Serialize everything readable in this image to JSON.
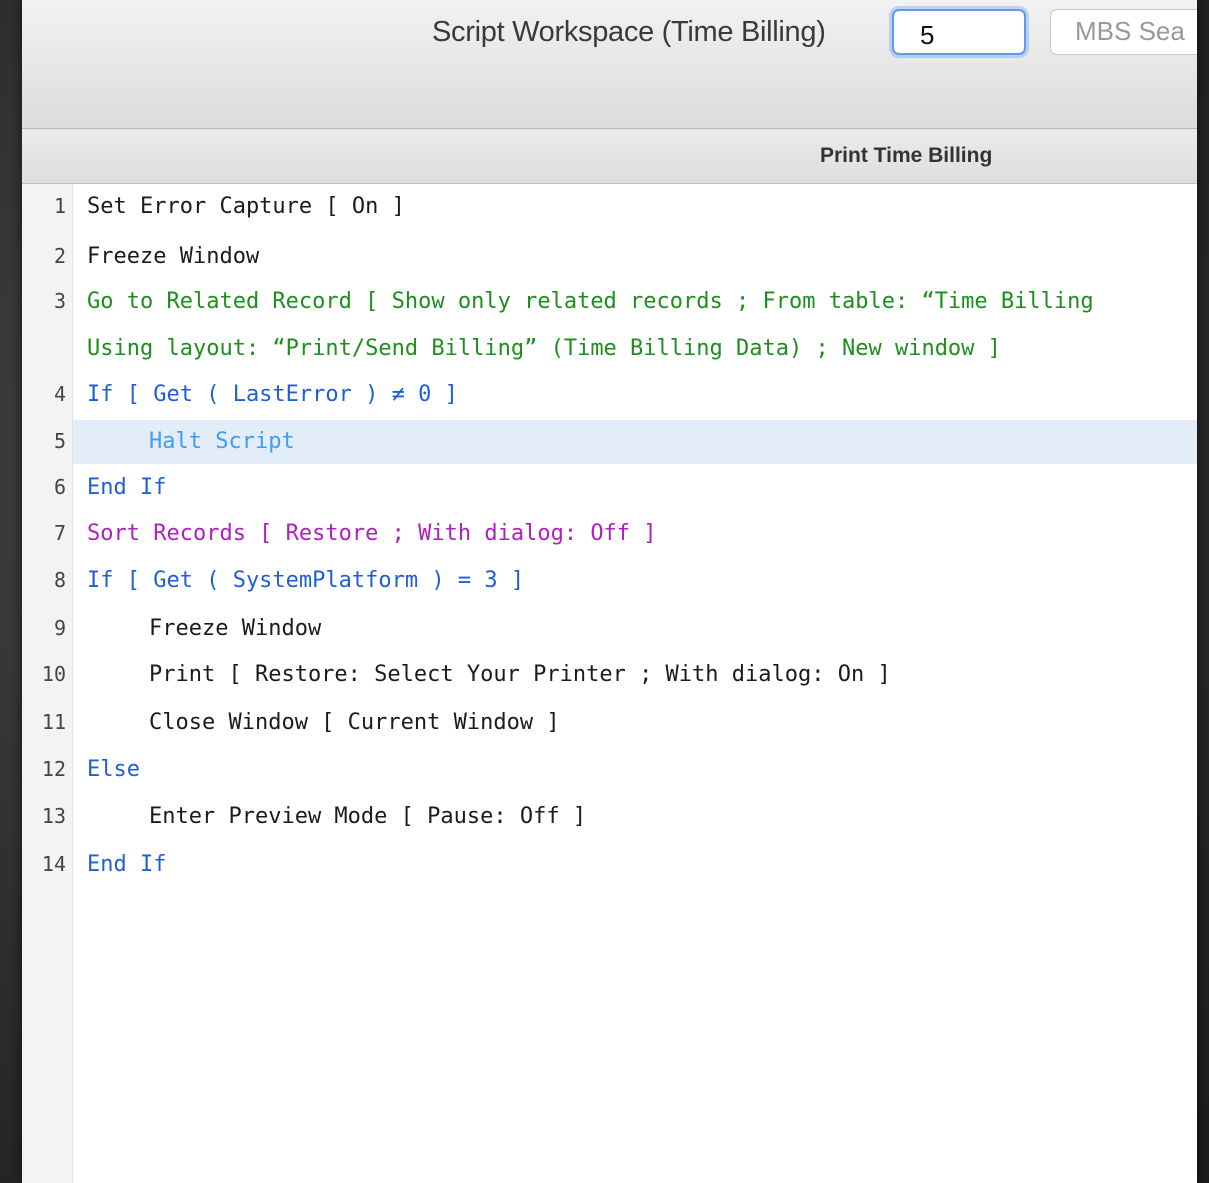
{
  "window": {
    "title": "Script Workspace (Time Billing)",
    "tab_field_value": "5",
    "search_field_text": "MBS Sea"
  },
  "script": {
    "name": "Print Time Billing",
    "lines": [
      {
        "num": "1",
        "text": "Set Error Capture [ On ]",
        "color": "#1b1b1b",
        "indent": false
      },
      {
        "num": "2",
        "text": "Freeze Window",
        "color": "#1b1b1b",
        "indent": false
      },
      {
        "num": "3",
        "text": "Go to Related Record [ Show only related records ; From table: “Time Billing",
        "color": "#1e8f1e",
        "indent": false
      },
      {
        "num": "",
        "text": "Using layout: “Print/Send Billing” (Time Billing Data) ; New window ]",
        "color": "#1e8f1e",
        "indent": false
      },
      {
        "num": "4",
        "text": "If [ Get ( LastError ) ≠ 0 ]",
        "color": "#1e5fd8",
        "indent": false
      },
      {
        "num": "5",
        "text": "Halt Script",
        "color": "#3e9ef0",
        "indent": true,
        "selected": true
      },
      {
        "num": "6",
        "text": "End If",
        "color": "#1e5fd8",
        "indent": false
      },
      {
        "num": "7",
        "text": "Sort Records [ Restore ; With dialog: Off ]",
        "color": "#b01fc0",
        "indent": false
      },
      {
        "num": "8",
        "text": "If [ Get ( SystemPlatform ) = 3 ]",
        "color": "#1e5fd8",
        "indent": false
      },
      {
        "num": "9",
        "text": "Freeze Window",
        "color": "#1b1b1b",
        "indent": true
      },
      {
        "num": "10",
        "text": "Print [ Restore: Select Your Printer ; With dialog: On ]",
        "color": "#1b1b1b",
        "indent": true
      },
      {
        "num": "11",
        "text": "Close Window [ Current Window ]",
        "color": "#1b1b1b",
        "indent": true
      },
      {
        "num": "12",
        "text": "Else",
        "color": "#1e5fd8",
        "indent": false
      },
      {
        "num": "13",
        "text": "Enter Preview Mode [ Pause: Off ]",
        "color": "#1b1b1b",
        "indent": true
      },
      {
        "num": "14",
        "text": "End If",
        "color": "#1e5fd8",
        "indent": false
      }
    ]
  }
}
